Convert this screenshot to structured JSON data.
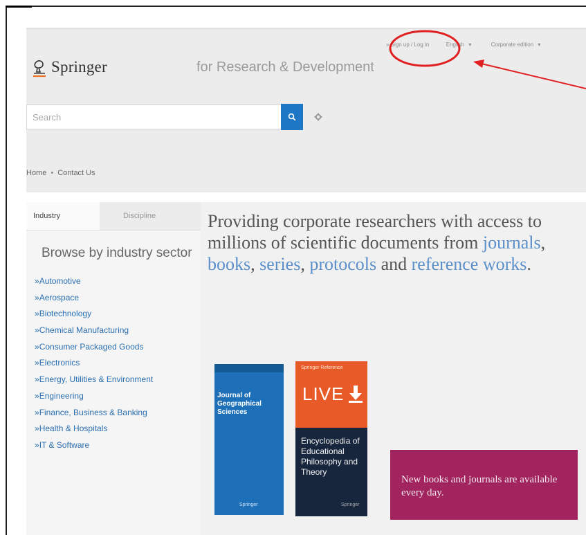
{
  "header": {
    "logo_text": "Springer",
    "tagline": "for Research & Development",
    "signup_login": "» Sign up / Log in",
    "language": "English",
    "edition": "Corporate edition"
  },
  "search": {
    "placeholder": "Search"
  },
  "breadcrumb": {
    "home": "Home",
    "contact": "Contact Us"
  },
  "sidebar": {
    "tabs": [
      "Industry",
      "Discipline"
    ],
    "heading": "Browse by industry sector",
    "items": [
      "Automotive",
      "Aerospace",
      "Biotechnology",
      "Chemical Manufacturing",
      "Consumer Packaged Goods",
      "Electronics",
      "Energy, Utilities & Environment",
      "Engineering",
      "Finance, Business & Banking",
      "Health & Hospitals",
      "IT & Software"
    ]
  },
  "main": {
    "headline": {
      "intro": "Providing corporate researchers with access to millions of scientific documents from",
      "journals": "journals",
      "books": "books",
      "series": "series",
      "protocols": "protocols",
      "and": "and",
      "reference": "reference works",
      "end": "."
    },
    "book1": {
      "title": "Journal of Geographical Sciences",
      "publisher": "Springer"
    },
    "book2": {
      "kicker": "Springer Reference",
      "live": "LIVE",
      "title": "Encyclopedia of Educational Philosophy and Theory",
      "publisher": "Springer"
    },
    "promo": "New books and journals are available every day."
  },
  "colors": {
    "accent_blue": "#1d77c4",
    "link_blue": "#5a8fc9",
    "promo_magenta": "#a1245e",
    "annotation_red": "#e02020"
  },
  "icons": {
    "search": "search-icon",
    "settings": "gear-icon",
    "logo": "springer-horse-logo",
    "download": "download-arrow-icon",
    "dropdown": "caret-down-icon"
  }
}
